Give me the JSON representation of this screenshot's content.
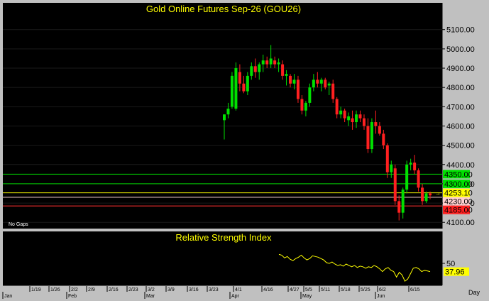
{
  "chart_data": [
    {
      "type": "candlestick",
      "title": "Gold Online Futures Sep-26 (GOU26)",
      "footnote": "No Gaps",
      "y_ticks": [
        4100,
        4200,
        4300,
        4400,
        4500,
        4600,
        4700,
        4800,
        4900,
        5000,
        5100
      ],
      "y_tick_labels": [
        "4100.00",
        "4200.00",
        "4300.00",
        "4400.00",
        "4500.00",
        "4600.00",
        "4700.00",
        "4800.00",
        "4900.00",
        "5000.00",
        "5100.00"
      ],
      "ylim": [
        4075,
        5180
      ],
      "candles": [
        {
          "o": 4630,
          "h": 4660,
          "l": 4530,
          "c": 4660
        },
        {
          "o": 4660,
          "h": 4720,
          "l": 4640,
          "c": 4690
        },
        {
          "o": 4700,
          "h": 4880,
          "l": 4690,
          "c": 4860
        },
        {
          "o": 4690,
          "h": 4930,
          "l": 4680,
          "c": 4900
        },
        {
          "o": 4880,
          "h": 4920,
          "l": 4780,
          "c": 4820
        },
        {
          "o": 4820,
          "h": 4860,
          "l": 4770,
          "c": 4780
        },
        {
          "o": 4780,
          "h": 4880,
          "l": 4760,
          "c": 4860
        },
        {
          "o": 4860,
          "h": 4930,
          "l": 4840,
          "c": 4910
        },
        {
          "o": 4910,
          "h": 4950,
          "l": 4850,
          "c": 4880
        },
        {
          "o": 4880,
          "h": 4930,
          "l": 4840,
          "c": 4920
        },
        {
          "o": 4920,
          "h": 4970,
          "l": 4880,
          "c": 4940
        },
        {
          "o": 4940,
          "h": 4960,
          "l": 4900,
          "c": 4920
        },
        {
          "o": 4920,
          "h": 5020,
          "l": 4900,
          "c": 4950
        },
        {
          "o": 4940,
          "h": 4960,
          "l": 4900,
          "c": 4920
        },
        {
          "o": 4920,
          "h": 4950,
          "l": 4880,
          "c": 4930
        },
        {
          "o": 4920,
          "h": 4940,
          "l": 4840,
          "c": 4860
        },
        {
          "o": 4860,
          "h": 4890,
          "l": 4810,
          "c": 4870
        },
        {
          "o": 4860,
          "h": 4870,
          "l": 4800,
          "c": 4820
        },
        {
          "o": 4820,
          "h": 4870,
          "l": 4790,
          "c": 4840
        },
        {
          "o": 4840,
          "h": 4860,
          "l": 4720,
          "c": 4740
        },
        {
          "o": 4740,
          "h": 4760,
          "l": 4660,
          "c": 4680
        },
        {
          "o": 4680,
          "h": 4730,
          "l": 4650,
          "c": 4720
        },
        {
          "o": 4720,
          "h": 4820,
          "l": 4700,
          "c": 4800
        },
        {
          "o": 4800,
          "h": 4870,
          "l": 4780,
          "c": 4840
        },
        {
          "o": 4840,
          "h": 4880,
          "l": 4800,
          "c": 4820
        },
        {
          "o": 4820,
          "h": 4850,
          "l": 4780,
          "c": 4840
        },
        {
          "o": 4840,
          "h": 4850,
          "l": 4790,
          "c": 4800
        },
        {
          "o": 4810,
          "h": 4830,
          "l": 4760,
          "c": 4820
        },
        {
          "o": 4820,
          "h": 4840,
          "l": 4720,
          "c": 4740
        },
        {
          "o": 4740,
          "h": 4750,
          "l": 4640,
          "c": 4660
        },
        {
          "o": 4660,
          "h": 4700,
          "l": 4640,
          "c": 4680
        },
        {
          "o": 4680,
          "h": 4690,
          "l": 4620,
          "c": 4640
        },
        {
          "o": 4630,
          "h": 4670,
          "l": 4600,
          "c": 4650
        },
        {
          "o": 4640,
          "h": 4680,
          "l": 4580,
          "c": 4620
        },
        {
          "o": 4620,
          "h": 4680,
          "l": 4590,
          "c": 4660
        },
        {
          "o": 4660,
          "h": 4680,
          "l": 4620,
          "c": 4640
        },
        {
          "o": 4640,
          "h": 4660,
          "l": 4580,
          "c": 4600
        },
        {
          "o": 4600,
          "h": 4640,
          "l": 4460,
          "c": 4480
        },
        {
          "o": 4480,
          "h": 4640,
          "l": 4460,
          "c": 4620
        },
        {
          "o": 4620,
          "h": 4680,
          "l": 4560,
          "c": 4600
        },
        {
          "o": 4600,
          "h": 4620,
          "l": 4550,
          "c": 4560
        },
        {
          "o": 4560,
          "h": 4580,
          "l": 4480,
          "c": 4500
        },
        {
          "o": 4500,
          "h": 4510,
          "l": 4330,
          "c": 4360
        },
        {
          "o": 4360,
          "h": 4420,
          "l": 4330,
          "c": 4400
        },
        {
          "o": 4380,
          "h": 4400,
          "l": 4190,
          "c": 4210
        },
        {
          "o": 4210,
          "h": 4240,
          "l": 4110,
          "c": 4150
        },
        {
          "o": 4150,
          "h": 4280,
          "l": 4120,
          "c": 4270
        },
        {
          "o": 4270,
          "h": 4420,
          "l": 4250,
          "c": 4400
        },
        {
          "o": 4400,
          "h": 4430,
          "l": 4370,
          "c": 4410
        },
        {
          "o": 4410,
          "h": 4450,
          "l": 4350,
          "c": 4370
        },
        {
          "o": 4370,
          "h": 4380,
          "l": 4260,
          "c": 4280
        },
        {
          "o": 4280,
          "h": 4300,
          "l": 4190,
          "c": 4210
        },
        {
          "o": 4210,
          "h": 4260,
          "l": 4200,
          "c": 4250
        },
        {
          "o": 4250,
          "h": 4260,
          "l": 4220,
          "c": 4240
        }
      ],
      "levels": [
        {
          "label": "4350.00",
          "value": 4350,
          "line": "#00d000",
          "bg": "#00e000",
          "fg": "#000000"
        },
        {
          "label": "4300.00",
          "value": 4300,
          "line": "#00d000",
          "bg": "#00e000",
          "fg": "#000000"
        },
        {
          "label": "4253.10",
          "value": 4253.1,
          "line": "#ffff00",
          "bg": "#ffff00",
          "fg": "#000000"
        },
        {
          "label": "4230.00",
          "value": 4230,
          "line": "#ffd8d8",
          "bg": "#ffd0d0",
          "fg": "#000000"
        },
        {
          "label": "4185.00",
          "value": 4185,
          "line": "#ff3030",
          "bg": "#ff2020",
          "fg": "#000000"
        }
      ],
      "colors": {
        "up": "#00e000",
        "down": "#ff2020",
        "title": "#ffff00",
        "background": "#000000"
      }
    },
    {
      "type": "line",
      "title": "Relative Strength Index",
      "y_ticks": [
        50
      ],
      "ylim": [
        20,
        80
      ],
      "last_value_label": "37.96",
      "last_value": 37.96,
      "series": [
        {
          "values": [
            63,
            62,
            58,
            60,
            56,
            54,
            57,
            59,
            62,
            58,
            55,
            57,
            61,
            60,
            59,
            57,
            55,
            51,
            50,
            52,
            49,
            47,
            48,
            46,
            49,
            47,
            45,
            47,
            44,
            46,
            45,
            43,
            45,
            44,
            47,
            45,
            42,
            38,
            42,
            44,
            40,
            38,
            30,
            37,
            33,
            24,
            27,
            35,
            43,
            44,
            42,
            38,
            40,
            39,
            38
          ]
        }
      ],
      "colors": {
        "line": "#ffff00"
      }
    }
  ],
  "x_axis": {
    "date_labels": [
      "1/19",
      "1/26",
      "2/2",
      "2/9",
      "2/16",
      "2/23",
      "3/2",
      "3/9",
      "3/16",
      "3/23",
      "4/1",
      "4/16",
      "4/27",
      "5/5",
      "5/11",
      "5/18",
      "5/25",
      "6/2",
      "6/15"
    ],
    "month_labels": [
      "Jan",
      "Feb",
      "Mar",
      "Apr",
      "May",
      "Jun"
    ],
    "period_label": "Day"
  }
}
